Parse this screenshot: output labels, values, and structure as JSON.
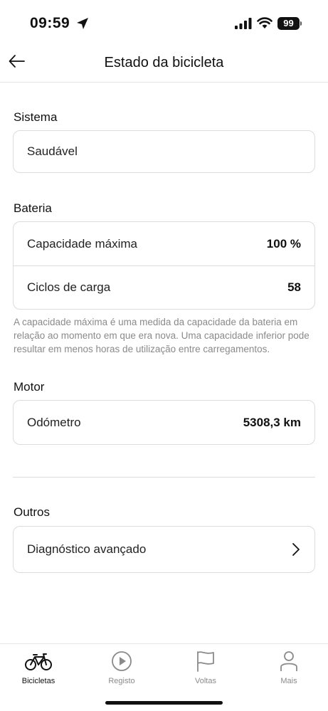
{
  "status_bar": {
    "time": "09:59",
    "battery": "99"
  },
  "header": {
    "title": "Estado da bicicleta"
  },
  "sistema": {
    "title": "Sistema",
    "status": "Saudável"
  },
  "bateria": {
    "title": "Bateria",
    "rows": [
      {
        "label": "Capacidade máxima",
        "value": "100 %"
      },
      {
        "label": "Ciclos de carga",
        "value": "58"
      }
    ],
    "note": "A capacidade máxima é uma medida da capacidade da bateria em relação ao momento em que era nova. Uma capacidade inferior pode resultar em menos horas de utilização entre carregamentos."
  },
  "motor": {
    "title": "Motor",
    "rows": [
      {
        "label": "Odómetro",
        "value": "5308,3 km"
      }
    ]
  },
  "outros": {
    "title": "Outros",
    "rows": [
      {
        "label": "Diagnóstico avançado"
      }
    ]
  },
  "tabs": [
    {
      "label": "Bicicletas",
      "icon": "bicycle-icon",
      "active": true
    },
    {
      "label": "Registo",
      "icon": "play-circle-icon",
      "active": false
    },
    {
      "label": "Voltas",
      "icon": "flag-icon",
      "active": false
    },
    {
      "label": "Mais",
      "icon": "person-icon",
      "active": false
    }
  ]
}
